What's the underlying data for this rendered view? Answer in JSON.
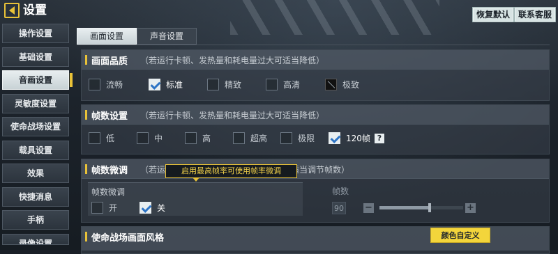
{
  "header": {
    "title": "设置",
    "restore_label": "恢复默认",
    "service_label": "联系客服"
  },
  "sidebar": {
    "items": [
      {
        "label": "操作设置"
      },
      {
        "label": "基础设置"
      },
      {
        "label": "音画设置"
      },
      {
        "label": "灵敏度设置"
      },
      {
        "label": "使命战场设置"
      },
      {
        "label": "载具设置"
      },
      {
        "label": "效果"
      },
      {
        "label": "快捷消息"
      },
      {
        "label": "手柄"
      },
      {
        "label": "录像设置"
      }
    ],
    "active_index": 2
  },
  "tabs": [
    {
      "label": "画面设置",
      "active": true
    },
    {
      "label": "声音设置",
      "active": false
    }
  ],
  "quality": {
    "title": "画面品质",
    "note": "（若运行卡顿、发热量和耗电量过大可适当降低）",
    "options": [
      {
        "label": "流畅",
        "checked": false
      },
      {
        "label": "标准",
        "checked": true
      },
      {
        "label": "精致",
        "checked": false
      },
      {
        "label": "高清",
        "checked": false
      },
      {
        "label": "极致",
        "checked": false,
        "disabled": true
      }
    ]
  },
  "framerate": {
    "title": "帧数设置",
    "note": "（若运行卡顿、发热量和耗电量过大可适当降低）",
    "options": [
      {
        "label": "低",
        "checked": false
      },
      {
        "label": "中",
        "checked": false
      },
      {
        "label": "高",
        "checked": false
      },
      {
        "label": "超高",
        "checked": false
      },
      {
        "label": "极限",
        "checked": false
      },
      {
        "label": "120帧",
        "checked": true
      }
    ],
    "help_label": "?"
  },
  "finetune": {
    "title": "帧数微调",
    "note": "（若运行卡顿、发热量和耗电量过大时可适当调节帧数）",
    "tooltip": "启用最高帧率可使用帧率微调",
    "toggle_label": "帧数微调",
    "on_label": "开",
    "off_label": "关",
    "on_checked": false,
    "off_checked": true,
    "fps_label": "帧数",
    "fps_value": "90",
    "minus_label": "−",
    "plus_label": "+",
    "slider_fraction": 0.6
  },
  "style": {
    "title": "使命战场画面风格",
    "custom_label": "颜色自定义"
  },
  "colors": {
    "accent": "#e9c238",
    "check": "#2d74c5"
  }
}
